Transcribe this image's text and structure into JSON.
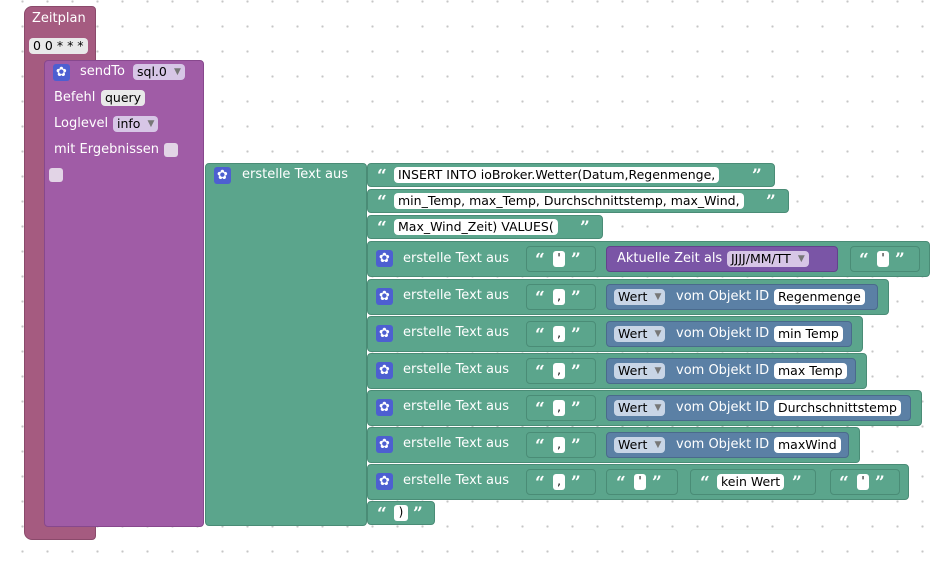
{
  "schedule": {
    "label": "Zeitplan",
    "cron": "0 0 * * *"
  },
  "sendto": {
    "label": "sendTo",
    "target": "sql.0",
    "befehl_label": "Befehl",
    "befehl": "query",
    "loglevel_label": "Loglevel",
    "loglevel": "info",
    "results_label": "mit Ergebnissen"
  },
  "text_join_label": "erstelle Text aus",
  "quote_open": "“",
  "quote_close": "”",
  "sql_parts": [
    "INSERT INTO ioBroker.Wetter(Datum,Regenmenge,",
    "min_Temp, max_Temp, Durchschnittstemp, max_Wind,",
    "Max_Wind_Zeit) VALUES("
  ],
  "time_block": {
    "label": "Aktuelle Zeit als",
    "format": "JJJJ/MM/TT"
  },
  "quote_char": "'",
  "comma_char": ",",
  "value_rows": [
    {
      "mode": "Wert",
      "label": "vom Objekt ID",
      "object": "Regenmenge"
    },
    {
      "mode": "Wert",
      "label": "vom Objekt ID",
      "object": "min Temp"
    },
    {
      "mode": "Wert",
      "label": "vom Objekt ID",
      "object": "max Temp"
    },
    {
      "mode": "Wert",
      "label": "vom Objekt ID",
      "object": "Durchschnittstemp"
    },
    {
      "mode": "Wert",
      "label": "vom Objekt ID",
      "object": "maxWind"
    }
  ],
  "no_value_text": "kein Wert",
  "closing_text": ")"
}
